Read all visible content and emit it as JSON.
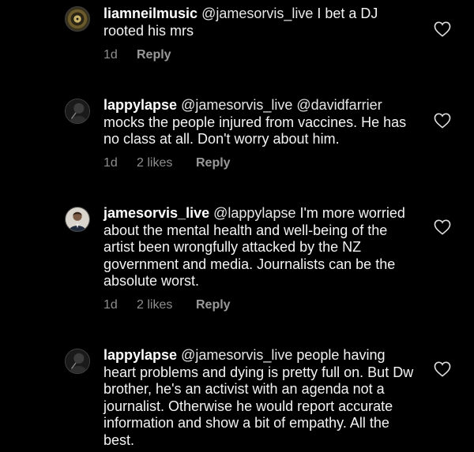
{
  "comments": [
    {
      "username": "liamneilmusic",
      "mention": "@jamesorvis_live",
      "text": " I bet a DJ rooted his mrs",
      "time": "1d",
      "likes": "",
      "reply_label": "Reply",
      "avatar": "vinyl-record-avatar"
    },
    {
      "username": "lappylapse",
      "mention": "@jamesorvis_live @davidfarrier",
      "text": " mocks the people injured from vaccines. He has no class at all. Don't worry about him.",
      "time": "1d",
      "likes": "2 likes",
      "reply_label": "Reply",
      "avatar": "dark-profile-avatar"
    },
    {
      "username": "jamesorvis_live",
      "mention": "@lappylapse",
      "text": " I'm more worried about the mental health and well-being of the artist been wrongfully attacked by the NZ government and media. Journalists can be the absolute worst.",
      "time": "1d",
      "likes": "2 likes",
      "reply_label": "Reply",
      "avatar": "person-portrait-avatar"
    },
    {
      "username": "lappylapse",
      "mention": "@jamesorvis_live",
      "text": " people having heart problems and dying is pretty full on. But Dw brother, he's an activist with an agenda not a journalist. Otherwise he would report accurate information and show a bit of empathy. All the best.",
      "time": "",
      "likes": "",
      "reply_label": "",
      "avatar": "dark-profile-avatar"
    }
  ]
}
